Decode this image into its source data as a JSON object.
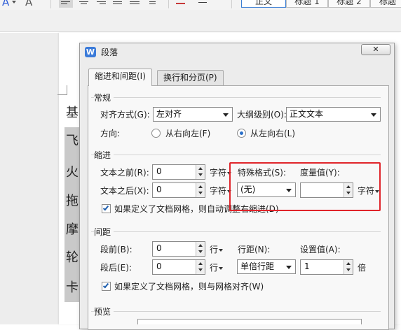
{
  "toolbar": {
    "font_color_glyph": "A",
    "style_gallery": [
      "正文",
      "标题 1",
      "标题 2",
      "标题"
    ]
  },
  "document": {
    "chars": [
      "基",
      "飞",
      "火",
      "拖",
      "摩",
      "轮",
      "卡"
    ]
  },
  "dialog": {
    "app_icon": "W",
    "title": "段落",
    "close_label": "✕",
    "tabs": [
      "缩进和间距(I)",
      "换行和分页(P)"
    ],
    "general": {
      "heading": "常规",
      "alignment_label": "对齐方式(G):",
      "alignment_value": "左对齐",
      "outline_label": "大纲级别(O):",
      "outline_value": "正文文本",
      "direction_label": "方向:",
      "rtl_label": "从右向左(F)",
      "ltr_label": "从左向右(L)",
      "direction_selected": "从左向右(L)"
    },
    "indent": {
      "heading": "缩进",
      "before_label": "文本之前(R):",
      "before_value": "0",
      "before_unit": "字符",
      "after_label": "文本之后(X):",
      "after_value": "0",
      "after_unit": "字符",
      "special_label": "特殊格式(S):",
      "special_value": "(无)",
      "amount_label": "度量值(Y):",
      "amount_value": "",
      "amount_unit": "字符",
      "grid_check_label": "如果定义了文档网格，则自动调整右缩进(D)",
      "grid_checked": true
    },
    "spacing": {
      "heading": "间距",
      "before_label": "段前(B):",
      "before_value": "0",
      "before_unit": "行",
      "after_label": "段后(E):",
      "after_value": "0",
      "after_unit": "行",
      "line_spacing_label": "行距(N):",
      "line_spacing_value": "单倍行距",
      "setting_label": "设置值(A):",
      "setting_value": "1",
      "setting_unit": "倍",
      "grid_check_label": "如果定义了文档网格，则与网格对齐(W)",
      "grid_checked": true
    },
    "preview": {
      "heading": "预览"
    }
  },
  "colors": {
    "highlight": "#e0242a",
    "accent": "#3b7bd9"
  },
  "icons": [
    "font-color-icon",
    "align-left-icon",
    "align-center-icon",
    "align-right-icon",
    "justify-icon",
    "distributed-icon",
    "line-spacing-icon",
    "shading-icon",
    "borders-icon",
    "app-icon",
    "close-icon",
    "dropdown-arrow-icon",
    "spin-up-icon",
    "spin-down-icon"
  ]
}
